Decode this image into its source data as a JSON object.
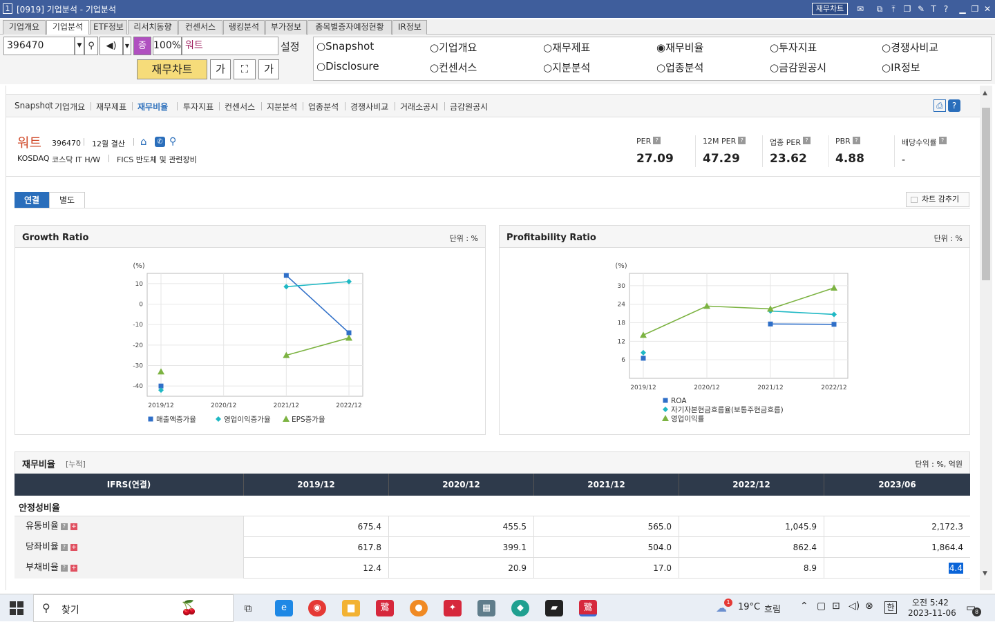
{
  "window": {
    "num": "1",
    "title": "[0919] 기업분석 - 기업분석",
    "fc_button": "재무차트"
  },
  "tabs": [
    "기업개요",
    "기업분석",
    "ETF정보",
    "리서치동향",
    "컨센서스",
    "랭킹분석",
    "부가정보",
    "종목별증자예정현황",
    "IR정보"
  ],
  "toolbar": {
    "code": "396470",
    "jong": "증",
    "pct": "100%",
    "name": "워트",
    "settings": "설정",
    "fin_chart_btn": "재무차트",
    "ga1": "가",
    "ga2": "가"
  },
  "radios": [
    "Snapshot",
    "기업개요",
    "재무제표",
    "재무비율",
    "투자지표",
    "경쟁사비교",
    "Disclosure",
    "컨센서스",
    "지분분석",
    "업종분석",
    "금감원공시",
    "IR정보"
  ],
  "subnav": [
    "Snapshot",
    "기업개요",
    "재무제표",
    "재무비율",
    "투자지표",
    "컨센서스",
    "지분분석",
    "업종분석",
    "경쟁사비교",
    "거래소공시",
    "금감원공시"
  ],
  "company": {
    "name": "워트",
    "code": "396470",
    "settle": "12월 결산",
    "market": "KOSDAQ",
    "sector": "코스닥 IT H/W",
    "fics": "FICS 반도체 및 관련장비"
  },
  "metrics": [
    {
      "label": "PER",
      "value": "27.09"
    },
    {
      "label": "12M PER",
      "value": "47.29"
    },
    {
      "label": "업종 PER",
      "value": "23.62"
    },
    {
      "label": "PBR",
      "value": "4.88"
    },
    {
      "label": "배당수익률",
      "value": "-"
    }
  ],
  "toggle": {
    "consol": "연결",
    "sep": "별도",
    "hide_chart": "차트 감추기"
  },
  "chart_data": [
    {
      "type": "line",
      "title": "Growth Ratio",
      "unit": "단위 : %",
      "ylabel": "(%)",
      "categories": [
        "2019/12",
        "2020/12",
        "2021/12",
        "2022/12"
      ],
      "ylim": [
        -45,
        15
      ],
      "yticks": [
        10,
        0,
        -10,
        -20,
        -30,
        -40
      ],
      "series": [
        {
          "name": "매출액증가율",
          "color": "#2f6fc8",
          "marker": "square",
          "values": [
            -40,
            null,
            14,
            -14
          ]
        },
        {
          "name": "영업이익증가율",
          "color": "#1fb8c4",
          "marker": "diamond",
          "values": [
            -42,
            null,
            8.5,
            11
          ]
        },
        {
          "name": "EPS증가율",
          "color": "#7cb342",
          "marker": "triangle",
          "values": [
            -33,
            null,
            -25,
            -16.5
          ]
        }
      ]
    },
    {
      "type": "line",
      "title": "Profitability Ratio",
      "unit": "단위 : %",
      "ylabel": "(%)",
      "categories": [
        "2019/12",
        "2020/12",
        "2021/12",
        "2022/12"
      ],
      "ylim": [
        0,
        34
      ],
      "yticks": [
        30,
        24,
        18,
        12,
        6
      ],
      "series": [
        {
          "name": "ROA",
          "color": "#2f6fc8",
          "marker": "square",
          "values": [
            6.5,
            null,
            17.6,
            17.5
          ]
        },
        {
          "name": "자기자본현금흐름율(보통주현금흐름)",
          "color": "#1fb8c4",
          "marker": "diamond",
          "values": [
            8.3,
            null,
            21.8,
            20.7
          ]
        },
        {
          "name": "영업이익률",
          "color": "#7cb342",
          "marker": "triangle",
          "values": [
            14,
            23.4,
            22.5,
            29.3
          ]
        }
      ]
    }
  ],
  "table": {
    "title": "재무비율",
    "tag": "[누적]",
    "unit": "단위 : %, 억원",
    "header": [
      "IFRS(연결)",
      "2019/12",
      "2020/12",
      "2021/12",
      "2022/12",
      "2023/06"
    ],
    "section": "안정성비율",
    "rows": [
      {
        "label": "유동비율",
        "values": [
          "675.4",
          "455.5",
          "565.0",
          "1,045.9",
          "2,172.3"
        ]
      },
      {
        "label": "당좌비율",
        "values": [
          "617.8",
          "399.1",
          "504.0",
          "862.4",
          "1,864.4"
        ]
      },
      {
        "label": "부채비율",
        "values": [
          "12.4",
          "20.9",
          "17.0",
          "8.9",
          "4.4"
        ]
      }
    ]
  },
  "taskbar": {
    "search": "찾기",
    "weather_temp": "19°C",
    "weather_desc": "흐림",
    "badge": "1",
    "ime": "한",
    "time": "오전 5:42",
    "date": "2023-11-06",
    "notif": "8"
  }
}
